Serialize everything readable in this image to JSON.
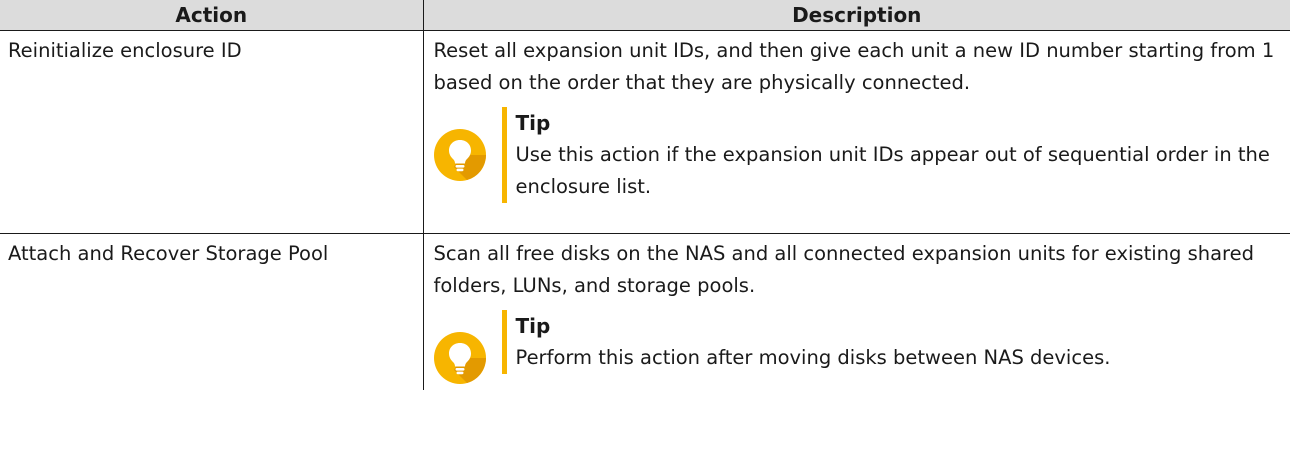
{
  "table": {
    "headers": {
      "action": "Action",
      "description": "Description"
    },
    "rows": [
      {
        "action": "Reinitialize enclosure ID",
        "description": "Reset all expansion unit IDs, and then give each unit a new ID number starting from 1 based on the order that they are physically connected.",
        "tip": {
          "icon": "lightbulb-icon",
          "label": "Tip",
          "text": "Use this action if the expansion unit IDs appear out of sequential order in the enclosure list."
        }
      },
      {
        "action": "Attach and Recover Storage Pool",
        "description": "Scan all free disks on the NAS and all connected expansion units for existing shared folders, LUNs, and storage pools.",
        "tip": {
          "icon": "lightbulb-icon",
          "label": "Tip",
          "text": "Perform this action after moving disks between NAS devices."
        }
      }
    ]
  },
  "colors": {
    "header_background": "#dcdcdc",
    "tip_accent": "#f7b500",
    "border": "#1a1a1a"
  }
}
